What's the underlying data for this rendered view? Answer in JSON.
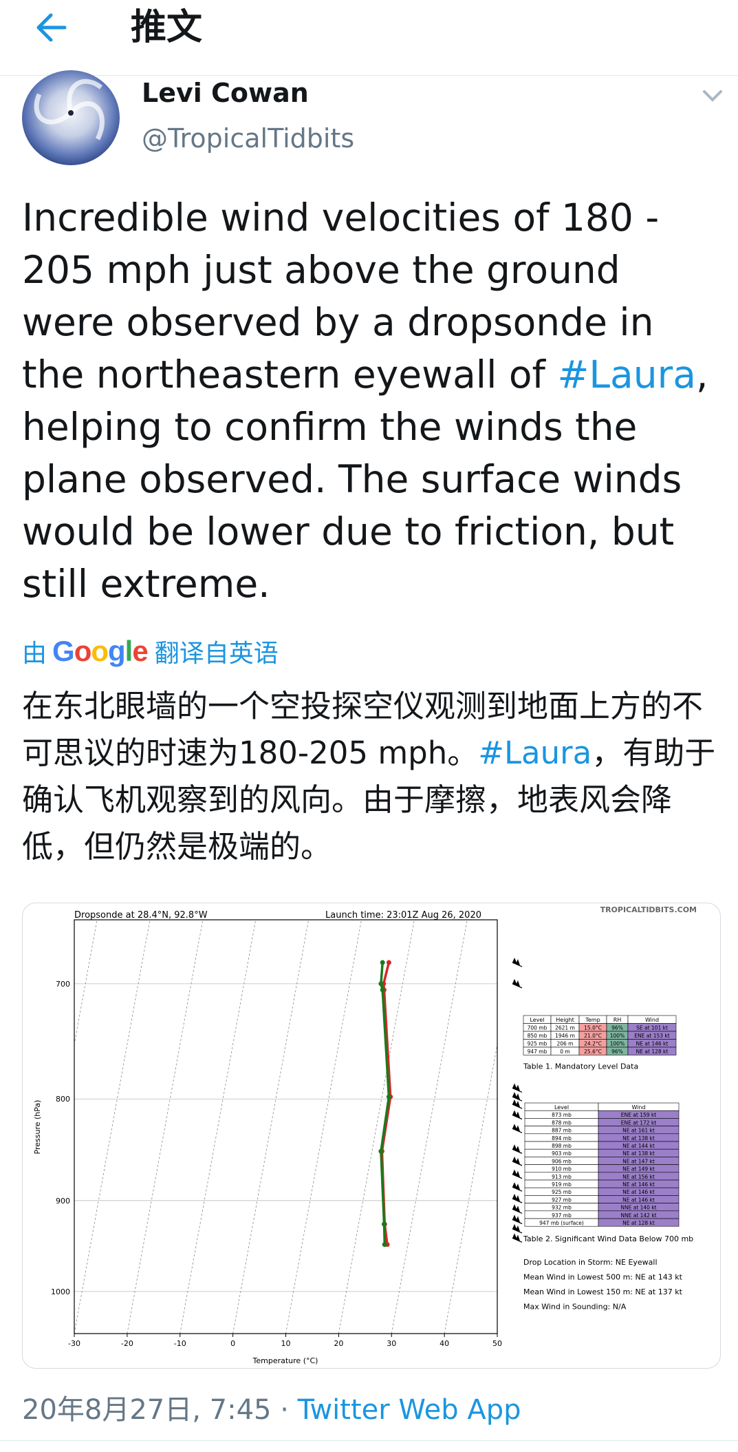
{
  "header": {
    "title": "推文"
  },
  "author": {
    "name": "Levi Cowan",
    "handle": "@TropicalTidbits"
  },
  "tweet": {
    "text_before": "Incredible wind velocities of 180 - 205 mph just above the ground were observed by a dropsonde in the northeastern eyewall of ",
    "hashtag": "#Laura",
    "text_after": ", helping to confirm the winds the plane observed. The surface winds would be lower due to friction, but still extreme."
  },
  "translation": {
    "prefix": "由",
    "provider": "Google",
    "suffix": "翻译自英语",
    "text_before": "在东北眼墙的一个空投探空仪观测到地面上方的不可思议的时速为180-205 mph。",
    "hashtag": "#Laura",
    "text_after": "，有助于确认飞机观察到的风向。由于摩擦，地表风会降低，但仍然是极端的。"
  },
  "footer": {
    "timestamp": "20年8月27日, 7:45 · ",
    "source": "Twitter Web App"
  },
  "chart_data": {
    "type": "line",
    "title": "Dropsonde at 28.4°N, 92.8°W",
    "subtitle": "Launch time: 23:01Z Aug 26, 2020",
    "watermark": "TROPICALTIDBITS.COM",
    "xlabel": "Temperature (°C)",
    "ylabel": "Pressure (hPa)",
    "xlim": [
      -30,
      50
    ],
    "ylim": [
      1050,
      650
    ],
    "y_log": true,
    "xticks": [
      -30,
      -20,
      -10,
      0,
      10,
      20,
      30,
      40,
      50
    ],
    "yticks": [
      700,
      800,
      900,
      1000
    ],
    "series": [
      {
        "color": "#d62728",
        "points": [
          [
            29.5,
            683
          ],
          [
            28.5,
            700
          ],
          [
            28.6,
            705
          ],
          [
            29.8,
            798
          ],
          [
            28.2,
            850
          ],
          [
            28.7,
            925
          ],
          [
            29.2,
            947
          ]
        ]
      },
      {
        "color": "#1b7a1b",
        "points": [
          [
            28.3,
            683
          ],
          [
            28.0,
            700
          ],
          [
            28.3,
            705
          ],
          [
            29.5,
            798
          ],
          [
            28.0,
            850
          ],
          [
            28.6,
            925
          ],
          [
            28.7,
            947
          ]
        ]
      }
    ],
    "tables": {
      "mandatory": {
        "columns": [
          "Level",
          "Height",
          "Temp",
          "RH",
          "Wind"
        ],
        "rows": [
          [
            "700 mb",
            "2621 m",
            "15.0°C",
            "96%",
            "SE at 101 kt"
          ],
          [
            "850 mb",
            "1946 m",
            "21.0°C",
            "100%",
            "ENE at 153 kt"
          ],
          [
            "925 mb",
            "206 m",
            "24.2°C",
            "100%",
            "NE at 146 kt"
          ],
          [
            "947 mb",
            "0 m",
            "25.6°C",
            "96%",
            "NE at 128 kt"
          ]
        ],
        "caption": "Table 1. Mandatory Level Data"
      },
      "significant": {
        "columns": [
          "Level",
          "Wind"
        ],
        "rows": [
          [
            "873 mb",
            "ENE at 159 kt"
          ],
          [
            "878 mb",
            "ENE at 172 kt"
          ],
          [
            "887 mb",
            "NE at 161 kt"
          ],
          [
            "894 mb",
            "NE at 138 kt"
          ],
          [
            "898 mb",
            "NE at 144 kt"
          ],
          [
            "903 mb",
            "NE at 138 kt"
          ],
          [
            "906 mb",
            "NE at 147 kt"
          ],
          [
            "910 mb",
            "NE at 149 kt"
          ],
          [
            "913 mb",
            "NE at 156 kt"
          ],
          [
            "919 mb",
            "NE at 146 kt"
          ],
          [
            "925 mb",
            "NE at 146 kt"
          ],
          [
            "927 mb",
            "NE at 146 kt"
          ],
          [
            "932 mb",
            "NNE at 140 kt"
          ],
          [
            "937 mb",
            "NNE at 142 kt"
          ],
          [
            "947 mb (surface)",
            "NE at 128 kt"
          ]
        ],
        "caption": "Table 2. Significant Wind Data Below 700 mb"
      }
    },
    "info": [
      "Drop Location in Storm: NE Eyewall",
      "Mean Wind in Lowest 500 m:  NE at 143 kt",
      "Mean Wind in Lowest 150 m:  NE at 137 kt",
      "Max Wind in Sounding:  N/A"
    ],
    "wind_barb_pressures": [
      683,
      700,
      790,
      798,
      805,
      815,
      828,
      848,
      860,
      873,
      886,
      898,
      909,
      920,
      930,
      940
    ]
  },
  "colors": {
    "link": "#1b95e0",
    "secondary": "#657786",
    "temp_cell": "#f4a0a0",
    "rh_cell": "#7fb5a0",
    "wind_cell": "#9b7fc9"
  }
}
